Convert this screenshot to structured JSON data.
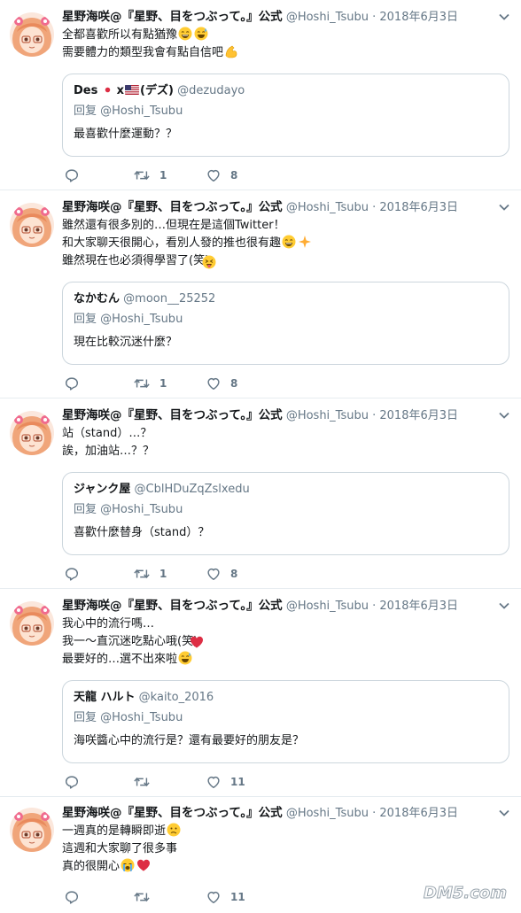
{
  "author": {
    "name": "星野海咲@『星野、目をつぶって。』公式",
    "handle": "@Hoshi_Tsubu",
    "date": "2018年6月3日"
  },
  "separator": "·",
  "reply_prefix": "回复",
  "tweets": [
    {
      "lines": [
        "全都喜歡所以有點猶豫",
        "需要體力的類型我會有點自信吧"
      ],
      "quote": {
        "name": "Des",
        "name_suffix": "x",
        "name_tail": "(デズ)",
        "handle": "@dezudayo",
        "reply_to": "@Hoshi_Tsubu",
        "text": "最喜歡什麼運動？？"
      },
      "retweets": "1",
      "likes": "8"
    },
    {
      "lines": [
        "雖然還有很多別的…但現在是這個Twitter！",
        "和大家聊天很開心，看別人發的推也很有趣",
        "雖然現在也必須得學習了(笑)"
      ],
      "quote": {
        "name": "なかむん",
        "handle": "@moon__25252",
        "reply_to": "@Hoshi_Tsubu",
        "text": "現在比較沉迷什麼？"
      },
      "retweets": "1",
      "likes": "8"
    },
    {
      "lines": [
        "站（stand）…？",
        "誒，加油站…？？"
      ],
      "quote": {
        "name": "ジャンク屋",
        "handle": "@CblHDuZqZslxedu",
        "reply_to": "@Hoshi_Tsubu",
        "text": "喜歡什麼替身（stand）？"
      },
      "retweets": "1",
      "likes": "8"
    },
    {
      "lines": [
        "我心中的流行嗎…",
        "我一～直沉迷吃點心哦(笑)",
        "最要好的…選不出來啦"
      ],
      "quote": {
        "name": "天龍 ハルト",
        "handle": "@kaito_2016",
        "reply_to": "@Hoshi_Tsubu",
        "text": "海咲醬心中的流行是？還有最要好的朋友是？"
      },
      "retweets": "",
      "likes": "11"
    },
    {
      "lines": [
        "一週真的是轉瞬即逝",
        "這週和大家聊了很多事",
        "真的很開心"
      ],
      "retweets": "",
      "likes": "11"
    }
  ],
  "watermark": "DM5.com",
  "colors": {
    "text": "#14171a",
    "muted": "#657786",
    "border": "#ccd6dd",
    "divider": "#e6ecf0",
    "heart_red": "#e0245e"
  }
}
